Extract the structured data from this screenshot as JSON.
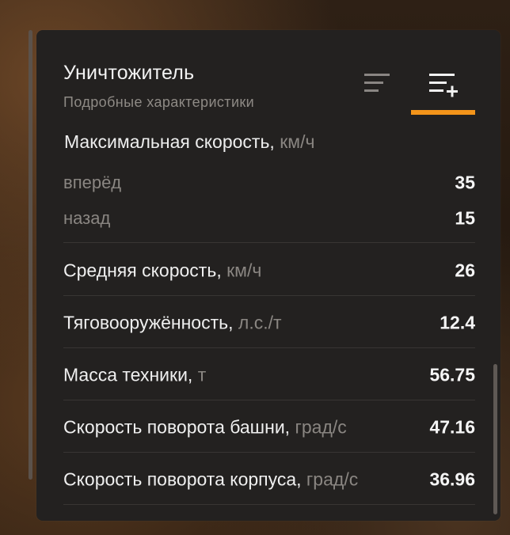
{
  "header": {
    "title": "Уничтожитель",
    "subtitle": "Подробные характеристики"
  },
  "tabs": [
    {
      "name": "compact-view",
      "icon": "list-lines-icon",
      "active": false
    },
    {
      "name": "detailed-view",
      "icon": "list-add-icon",
      "active": true
    }
  ],
  "accent_color": "#f3941a",
  "max_speed": {
    "label": "Максимальная скорость,",
    "unit": "км/ч",
    "forward_label": "вперёд",
    "forward_value": "35",
    "reverse_label": "назад",
    "reverse_value": "15"
  },
  "stats": [
    {
      "label": "Средняя скорость,",
      "unit": "км/ч",
      "value": "26"
    },
    {
      "label": "Тяговооружённость,",
      "unit": "л.с./т",
      "value": "12.4"
    },
    {
      "label": "Масса техники,",
      "unit": "т",
      "value": "56.75"
    },
    {
      "label": "Скорость поворота башни,",
      "unit": "град/с",
      "value": "47.16"
    },
    {
      "label": "Скорость поворота корпуса,",
      "unit": "град/с",
      "value": "36.96"
    }
  ]
}
